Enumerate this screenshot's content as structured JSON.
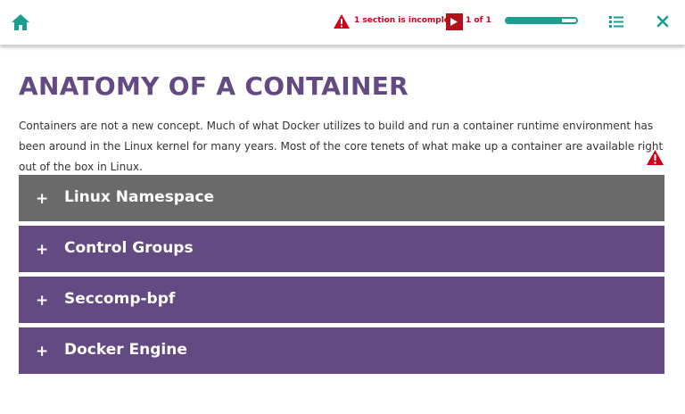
{
  "header": {
    "home_icon": "home-icon",
    "warning_text": "1 section is incomplete!",
    "page_count": "1 of 1",
    "progress": 0.8,
    "menu_icon": "list-icon",
    "close_icon": "close-icon"
  },
  "page": {
    "title": "ANATOMY OF A CONTAINER",
    "intro": "Containers are not a new concept. Much of what Docker utilizes to build and run a container runtime environment has been around in the Linux kernel for many years. Most of the core tenets of what make up a container are available right out of the box in Linux."
  },
  "accordion": {
    "items": [
      {
        "label": "Linux Namespace",
        "icon": "+"
      },
      {
        "label": "Control Groups",
        "icon": "+"
      },
      {
        "label": "Seccomp-bpf",
        "icon": "+"
      },
      {
        "label": "Docker Engine",
        "icon": "+"
      }
    ]
  },
  "colors": {
    "accent": "#634a82",
    "active": "#6a6a6a",
    "teal": "#1a9e8f",
    "warning": "#d0021b"
  }
}
